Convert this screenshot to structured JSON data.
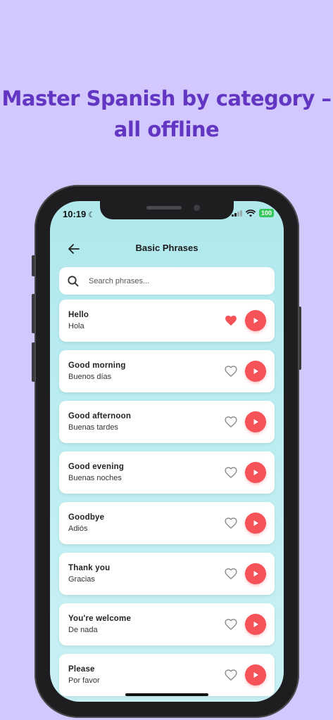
{
  "promo": {
    "headline_line1": "Master Spanish by category –",
    "headline_line2": "all offline"
  },
  "status_bar": {
    "time": "10:19",
    "battery": "100"
  },
  "header": {
    "title": "Basic Phrases",
    "back_icon": "arrow-left-icon"
  },
  "search": {
    "placeholder": "Search phrases...",
    "value": "",
    "icon": "search-icon"
  },
  "phrases": [
    {
      "english": "Hello",
      "spanish": "Hola",
      "favorite": true
    },
    {
      "english": "Good morning",
      "spanish": "Buenos días",
      "favorite": false
    },
    {
      "english": "Good afternoon",
      "spanish": "Buenas tardes",
      "favorite": false
    },
    {
      "english": "Good evening",
      "spanish": "Buenas noches",
      "favorite": false
    },
    {
      "english": "Goodbye",
      "spanish": "Adiós",
      "favorite": false
    },
    {
      "english": "Thank you",
      "spanish": "Gracias",
      "favorite": false
    },
    {
      "english": "You're welcome",
      "spanish": "De nada",
      "favorite": false
    },
    {
      "english": "Please",
      "spanish": "Por favor",
      "favorite": false
    }
  ],
  "colors": {
    "background": "#d2c8fd",
    "headline": "#6236c2",
    "play_button": "#f55357",
    "heart_active": "#f55357",
    "heart_inactive": "#8a8a8a",
    "screen_bg": "#b0e8ec"
  }
}
